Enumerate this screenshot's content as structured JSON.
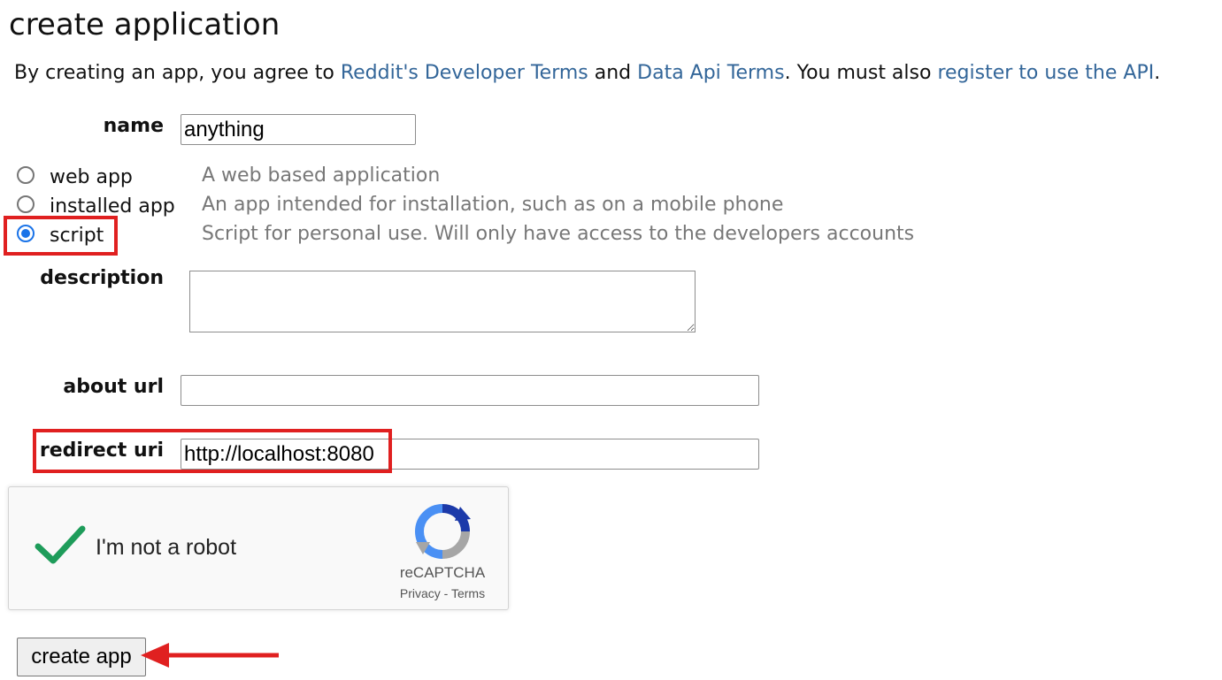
{
  "page": {
    "title": "create application"
  },
  "terms": {
    "prefix": "By creating an app, you agree to ",
    "developer_terms_link": "Reddit's Developer Terms",
    "and": " and ",
    "data_api_link": "Data Api Terms",
    "middle": ". You must also ",
    "register_link": "register to use the API",
    "suffix": "."
  },
  "form": {
    "name_label": "name",
    "name_value": "anything",
    "app_types": [
      {
        "label": "web app",
        "description": "A web based application",
        "checked": false
      },
      {
        "label": "installed app",
        "description": "An app intended for installation, such as on a mobile phone",
        "checked": false
      },
      {
        "label": "script",
        "description": "Script for personal use. Will only have access to the developers accounts",
        "checked": true
      }
    ],
    "description_label": "description",
    "description_value": "",
    "about_url_label": "about url",
    "about_url_value": "",
    "redirect_uri_label": "redirect uri",
    "redirect_uri_value": "http://localhost:8080"
  },
  "captcha": {
    "checkbox_label": "I'm not a robot",
    "brand": "reCAPTCHA",
    "privacy_link": "Privacy",
    "separator": " - ",
    "terms_link": "Terms",
    "checked": true
  },
  "submit": {
    "label": "create app"
  },
  "annotations": {
    "highlight_color": "#e02020"
  }
}
